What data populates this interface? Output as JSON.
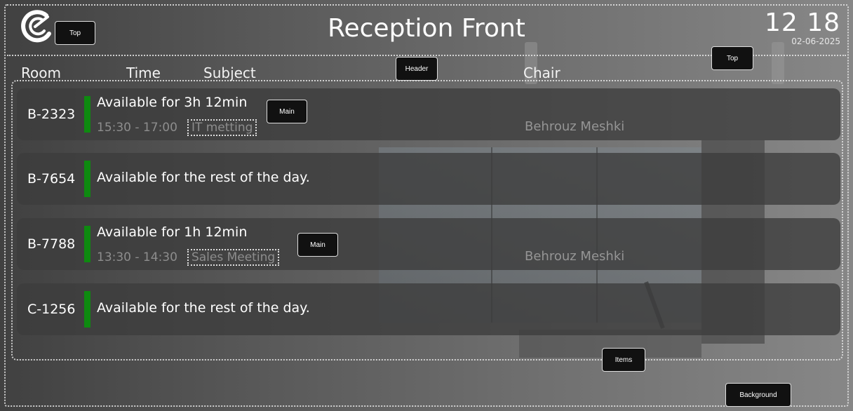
{
  "header": {
    "title": "Reception Front",
    "clock_time": "12 18",
    "clock_date": "02-06-2025"
  },
  "columns": {
    "room": "Room",
    "time": "Time",
    "subject": "Subject",
    "chair": "Chair"
  },
  "rows": [
    {
      "room": "B-2323",
      "status": "Available for 3h 12min",
      "time": "15:30 - 17:00",
      "subject": "IT metting",
      "chair": "Behrouz Meshki"
    },
    {
      "room": "B-7654",
      "status": "Available for the rest of the day."
    },
    {
      "room": "B-7788",
      "status": "Available for 1h 12min",
      "time": "13:30 - 14:30",
      "subject": "Sales Meeting",
      "chair": "Behrouz Meshki"
    },
    {
      "room": "C-1256",
      "status": "Available for the rest of the day."
    }
  ],
  "tags": {
    "top_left": "Top",
    "header": "Header",
    "top_right": "Top",
    "main_1": "Main",
    "main_2": "Main",
    "items": "Items",
    "background": "Background"
  },
  "colors": {
    "available": "#0e8a10"
  },
  "icons": {
    "logo": "logo-icon"
  }
}
